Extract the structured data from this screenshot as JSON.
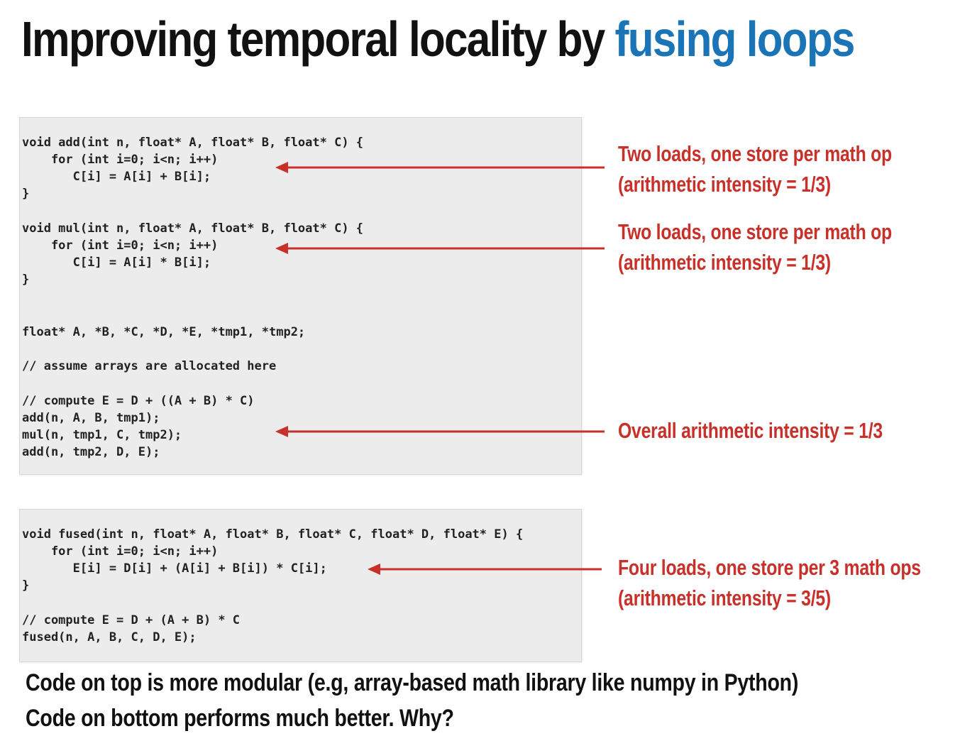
{
  "title": {
    "prefix": "Improving temporal locality by ",
    "accent": "fusing loops"
  },
  "colors": {
    "title_accent": "#1a74b5",
    "annotation": "#c8302a",
    "arrow": "#c8302a",
    "code_background": "#ececec"
  },
  "top_code": {
    "add_fn": [
      "void add(int n, float* A, float* B, float* C) {",
      "    for (int i=0; i<n; i++)",
      "       C[i] = A[i] + B[i];",
      "}"
    ],
    "mul_fn": [
      "void mul(int n, float* A, float* B, float* C) {",
      "    for (int i=0; i<n; i++)",
      "       C[i] = A[i] * B[i];",
      "}"
    ],
    "decl": "float* A, *B, *C, *D, *E, *tmp1, *tmp2;",
    "alloc_comment": "// assume arrays are allocated here",
    "compute": [
      "// compute E = D + ((A + B) * C)",
      "add(n, A, B, tmp1);",
      "mul(n, tmp1, C, tmp2);",
      "add(n, tmp2, D, E);"
    ]
  },
  "bottom_code": {
    "fused_fn": [
      "void fused(int n, float* A, float* B, float* C, float* D, float* E) {",
      "    for (int i=0; i<n; i++)",
      "       E[i] = D[i] + (A[i] + B[i]) * C[i];",
      "}"
    ],
    "compute": [
      "// compute E = D + (A + B) * C",
      "fused(n, A, B, C, D, E);"
    ]
  },
  "annotations": {
    "add": {
      "line1": "Two loads, one store per math op",
      "line2": "(arithmetic intensity = 1/3)"
    },
    "mul": {
      "line1": "Two loads, one store per math op",
      "line2": "(arithmetic intensity = 1/3)"
    },
    "overall": {
      "line1": "Overall arithmetic intensity = 1/3"
    },
    "fused": {
      "line1": "Four loads, one store per 3 math ops",
      "line2": "(arithmetic intensity = 3/5)"
    }
  },
  "footer": {
    "line1": "Code on top is more modular (e.g, array-based math library like numpy in Python)",
    "line2": "Code on bottom performs much better. Why?"
  }
}
